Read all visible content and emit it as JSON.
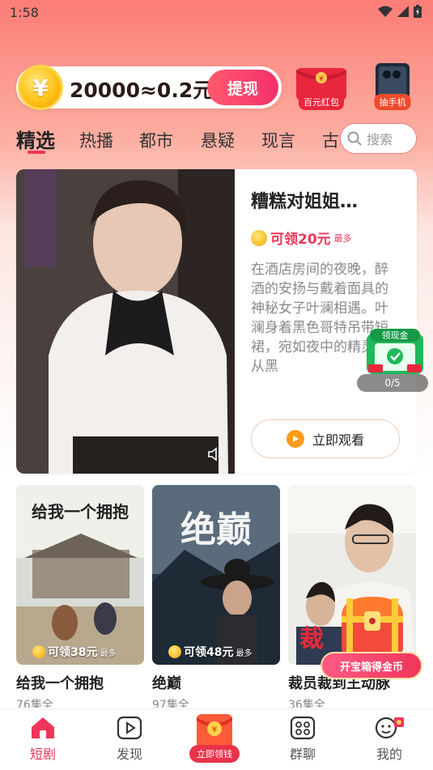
{
  "status_bar": {
    "time": "1:58"
  },
  "coin_bar": {
    "symbol": "¥",
    "value": "20000≈0.2元",
    "withdraw_label": "提现"
  },
  "promos": [
    {
      "label": "百元红包",
      "color": "#e8273d"
    },
    {
      "label": "抽手机",
      "color": "#ef4a2a"
    }
  ],
  "tabs": [
    "精选",
    "热播",
    "都市",
    "悬疑",
    "现言",
    "古"
  ],
  "active_tab": "精选",
  "search": {
    "placeholder": "搜索"
  },
  "featured": {
    "title": "糟糕对姐姐…",
    "reward": "可领20元",
    "reward_suffix": "最多",
    "description": "在酒店房间的夜晚，醉酒的安扬与戴着面具的神秘女子叶澜相遇。叶澜身着黑色哥特吊带短裙，宛如夜中的精灵，从黑",
    "watch_label": "立即观看"
  },
  "floating_cash": {
    "title": "领现金",
    "progress": "0/5"
  },
  "cards": [
    {
      "title": "给我一个拥抱",
      "episodes": "76集全",
      "reward": "可领38元",
      "reward_suffix": "最多",
      "poster_text": "给我一个拥抱"
    },
    {
      "title": "绝巅",
      "episodes": "97集全",
      "reward": "可领48元",
      "reward_suffix": "最多",
      "poster_text": "绝巅"
    },
    {
      "title": "裁员裁到王动脉",
      "episodes": "36集全",
      "reward": "",
      "reward_suffix": "",
      "poster_text": "裁"
    }
  ],
  "treasure": {
    "label": "开宝箱得金币"
  },
  "bottom_nav": [
    {
      "label": "短剧",
      "icon": "home-icon"
    },
    {
      "label": "发现",
      "icon": "play-icon"
    },
    {
      "label": "立即领钱",
      "icon": "red-envelope-icon"
    },
    {
      "label": "群聊",
      "icon": "group-chat-icon"
    },
    {
      "label": "我的",
      "icon": "profile-icon"
    }
  ],
  "accent": "#f0355a"
}
